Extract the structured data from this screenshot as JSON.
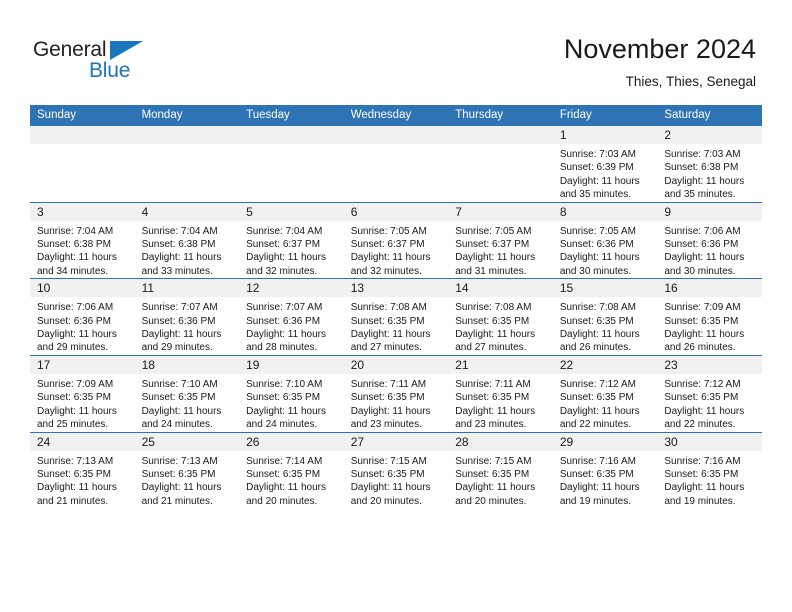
{
  "brand": {
    "name_part1": "General",
    "name_part2": "Blue"
  },
  "header": {
    "title": "November 2024",
    "subtitle": "Thies, Thies, Senegal"
  },
  "colors": {
    "header_blue": "#2e74b5",
    "logo_blue": "#1b75bb",
    "daynum_band": "#f1f1f1",
    "text": "#1a1a1a"
  },
  "weekdays": [
    "Sunday",
    "Monday",
    "Tuesday",
    "Wednesday",
    "Thursday",
    "Friday",
    "Saturday"
  ],
  "weeks": [
    [
      {
        "day": "",
        "sunrise": "",
        "sunset": "",
        "daylight_line1": "",
        "daylight_line2": "",
        "empty": true
      },
      {
        "day": "",
        "sunrise": "",
        "sunset": "",
        "daylight_line1": "",
        "daylight_line2": "",
        "empty": true
      },
      {
        "day": "",
        "sunrise": "",
        "sunset": "",
        "daylight_line1": "",
        "daylight_line2": "",
        "empty": true
      },
      {
        "day": "",
        "sunrise": "",
        "sunset": "",
        "daylight_line1": "",
        "daylight_line2": "",
        "empty": true
      },
      {
        "day": "",
        "sunrise": "",
        "sunset": "",
        "daylight_line1": "",
        "daylight_line2": "",
        "empty": true
      },
      {
        "day": "1",
        "sunrise": "Sunrise: 7:03 AM",
        "sunset": "Sunset: 6:39 PM",
        "daylight_line1": "Daylight: 11 hours",
        "daylight_line2": "and 35 minutes.",
        "empty": false
      },
      {
        "day": "2",
        "sunrise": "Sunrise: 7:03 AM",
        "sunset": "Sunset: 6:38 PM",
        "daylight_line1": "Daylight: 11 hours",
        "daylight_line2": "and 35 minutes.",
        "empty": false
      }
    ],
    [
      {
        "day": "3",
        "sunrise": "Sunrise: 7:04 AM",
        "sunset": "Sunset: 6:38 PM",
        "daylight_line1": "Daylight: 11 hours",
        "daylight_line2": "and 34 minutes.",
        "empty": false
      },
      {
        "day": "4",
        "sunrise": "Sunrise: 7:04 AM",
        "sunset": "Sunset: 6:38 PM",
        "daylight_line1": "Daylight: 11 hours",
        "daylight_line2": "and 33 minutes.",
        "empty": false
      },
      {
        "day": "5",
        "sunrise": "Sunrise: 7:04 AM",
        "sunset": "Sunset: 6:37 PM",
        "daylight_line1": "Daylight: 11 hours",
        "daylight_line2": "and 32 minutes.",
        "empty": false
      },
      {
        "day": "6",
        "sunrise": "Sunrise: 7:05 AM",
        "sunset": "Sunset: 6:37 PM",
        "daylight_line1": "Daylight: 11 hours",
        "daylight_line2": "and 32 minutes.",
        "empty": false
      },
      {
        "day": "7",
        "sunrise": "Sunrise: 7:05 AM",
        "sunset": "Sunset: 6:37 PM",
        "daylight_line1": "Daylight: 11 hours",
        "daylight_line2": "and 31 minutes.",
        "empty": false
      },
      {
        "day": "8",
        "sunrise": "Sunrise: 7:05 AM",
        "sunset": "Sunset: 6:36 PM",
        "daylight_line1": "Daylight: 11 hours",
        "daylight_line2": "and 30 minutes.",
        "empty": false
      },
      {
        "day": "9",
        "sunrise": "Sunrise: 7:06 AM",
        "sunset": "Sunset: 6:36 PM",
        "daylight_line1": "Daylight: 11 hours",
        "daylight_line2": "and 30 minutes.",
        "empty": false
      }
    ],
    [
      {
        "day": "10",
        "sunrise": "Sunrise: 7:06 AM",
        "sunset": "Sunset: 6:36 PM",
        "daylight_line1": "Daylight: 11 hours",
        "daylight_line2": "and 29 minutes.",
        "empty": false
      },
      {
        "day": "11",
        "sunrise": "Sunrise: 7:07 AM",
        "sunset": "Sunset: 6:36 PM",
        "daylight_line1": "Daylight: 11 hours",
        "daylight_line2": "and 29 minutes.",
        "empty": false
      },
      {
        "day": "12",
        "sunrise": "Sunrise: 7:07 AM",
        "sunset": "Sunset: 6:36 PM",
        "daylight_line1": "Daylight: 11 hours",
        "daylight_line2": "and 28 minutes.",
        "empty": false
      },
      {
        "day": "13",
        "sunrise": "Sunrise: 7:08 AM",
        "sunset": "Sunset: 6:35 PM",
        "daylight_line1": "Daylight: 11 hours",
        "daylight_line2": "and 27 minutes.",
        "empty": false
      },
      {
        "day": "14",
        "sunrise": "Sunrise: 7:08 AM",
        "sunset": "Sunset: 6:35 PM",
        "daylight_line1": "Daylight: 11 hours",
        "daylight_line2": "and 27 minutes.",
        "empty": false
      },
      {
        "day": "15",
        "sunrise": "Sunrise: 7:08 AM",
        "sunset": "Sunset: 6:35 PM",
        "daylight_line1": "Daylight: 11 hours",
        "daylight_line2": "and 26 minutes.",
        "empty": false
      },
      {
        "day": "16",
        "sunrise": "Sunrise: 7:09 AM",
        "sunset": "Sunset: 6:35 PM",
        "daylight_line1": "Daylight: 11 hours",
        "daylight_line2": "and 26 minutes.",
        "empty": false
      }
    ],
    [
      {
        "day": "17",
        "sunrise": "Sunrise: 7:09 AM",
        "sunset": "Sunset: 6:35 PM",
        "daylight_line1": "Daylight: 11 hours",
        "daylight_line2": "and 25 minutes.",
        "empty": false
      },
      {
        "day": "18",
        "sunrise": "Sunrise: 7:10 AM",
        "sunset": "Sunset: 6:35 PM",
        "daylight_line1": "Daylight: 11 hours",
        "daylight_line2": "and 24 minutes.",
        "empty": false
      },
      {
        "day": "19",
        "sunrise": "Sunrise: 7:10 AM",
        "sunset": "Sunset: 6:35 PM",
        "daylight_line1": "Daylight: 11 hours",
        "daylight_line2": "and 24 minutes.",
        "empty": false
      },
      {
        "day": "20",
        "sunrise": "Sunrise: 7:11 AM",
        "sunset": "Sunset: 6:35 PM",
        "daylight_line1": "Daylight: 11 hours",
        "daylight_line2": "and 23 minutes.",
        "empty": false
      },
      {
        "day": "21",
        "sunrise": "Sunrise: 7:11 AM",
        "sunset": "Sunset: 6:35 PM",
        "daylight_line1": "Daylight: 11 hours",
        "daylight_line2": "and 23 minutes.",
        "empty": false
      },
      {
        "day": "22",
        "sunrise": "Sunrise: 7:12 AM",
        "sunset": "Sunset: 6:35 PM",
        "daylight_line1": "Daylight: 11 hours",
        "daylight_line2": "and 22 minutes.",
        "empty": false
      },
      {
        "day": "23",
        "sunrise": "Sunrise: 7:12 AM",
        "sunset": "Sunset: 6:35 PM",
        "daylight_line1": "Daylight: 11 hours",
        "daylight_line2": "and 22 minutes.",
        "empty": false
      }
    ],
    [
      {
        "day": "24",
        "sunrise": "Sunrise: 7:13 AM",
        "sunset": "Sunset: 6:35 PM",
        "daylight_line1": "Daylight: 11 hours",
        "daylight_line2": "and 21 minutes.",
        "empty": false
      },
      {
        "day": "25",
        "sunrise": "Sunrise: 7:13 AM",
        "sunset": "Sunset: 6:35 PM",
        "daylight_line1": "Daylight: 11 hours",
        "daylight_line2": "and 21 minutes.",
        "empty": false
      },
      {
        "day": "26",
        "sunrise": "Sunrise: 7:14 AM",
        "sunset": "Sunset: 6:35 PM",
        "daylight_line1": "Daylight: 11 hours",
        "daylight_line2": "and 20 minutes.",
        "empty": false
      },
      {
        "day": "27",
        "sunrise": "Sunrise: 7:15 AM",
        "sunset": "Sunset: 6:35 PM",
        "daylight_line1": "Daylight: 11 hours",
        "daylight_line2": "and 20 minutes.",
        "empty": false
      },
      {
        "day": "28",
        "sunrise": "Sunrise: 7:15 AM",
        "sunset": "Sunset: 6:35 PM",
        "daylight_line1": "Daylight: 11 hours",
        "daylight_line2": "and 20 minutes.",
        "empty": false
      },
      {
        "day": "29",
        "sunrise": "Sunrise: 7:16 AM",
        "sunset": "Sunset: 6:35 PM",
        "daylight_line1": "Daylight: 11 hours",
        "daylight_line2": "and 19 minutes.",
        "empty": false
      },
      {
        "day": "30",
        "sunrise": "Sunrise: 7:16 AM",
        "sunset": "Sunset: 6:35 PM",
        "daylight_line1": "Daylight: 11 hours",
        "daylight_line2": "and 19 minutes.",
        "empty": false
      }
    ]
  ]
}
